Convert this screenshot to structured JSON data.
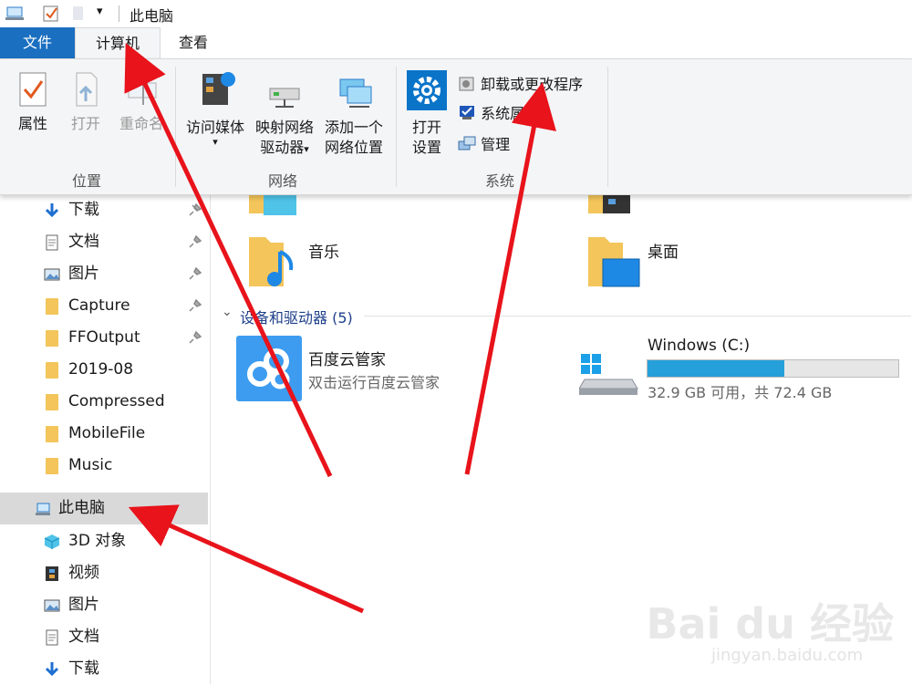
{
  "window": {
    "title": "此电脑"
  },
  "tabs": {
    "file": "文件",
    "computer": "计算机",
    "view": "查看"
  },
  "ribbon": {
    "location": {
      "properties": "属性",
      "open": "打开",
      "rename": "重命名",
      "label": "位置"
    },
    "network": {
      "access_media": "访问媒体",
      "map_drive_1": "映射网络",
      "map_drive_2": "驱动器",
      "add_location_1": "添加一个",
      "add_location_2": "网络位置",
      "label": "网络"
    },
    "system": {
      "open_settings_1": "打开",
      "open_settings_2": "设置",
      "uninstall": "卸载或更改程序",
      "properties": "系统属性",
      "manage": "管理",
      "label": "系统"
    }
  },
  "nav": {
    "quick": [
      "下载",
      "文档",
      "图片",
      "Capture",
      "FFOutput",
      "2019-08",
      "Compressed",
      "MobileFile",
      "Music"
    ],
    "this_pc": "此电脑",
    "pc_items": [
      "3D 对象",
      "视频",
      "图片",
      "文档",
      "下载"
    ]
  },
  "content": {
    "folders": {
      "music": "音乐",
      "desktop": "桌面"
    },
    "section_header": "设备和驱动器 (5)",
    "devices": {
      "baidu_name": "百度云管家",
      "baidu_desc": "双击运行百度云管家",
      "windows_name": "Windows (C:)",
      "windows_space": "32.9 GB 可用，共 72.4 GB",
      "used_fraction": 0.545
    }
  },
  "watermark": {
    "brand": "Bai du 经验",
    "url": "jingyan.baidu.com"
  },
  "colors": {
    "accent": "#1a6fc0",
    "bar": "#26a0da",
    "arrow": "#e8131b"
  }
}
